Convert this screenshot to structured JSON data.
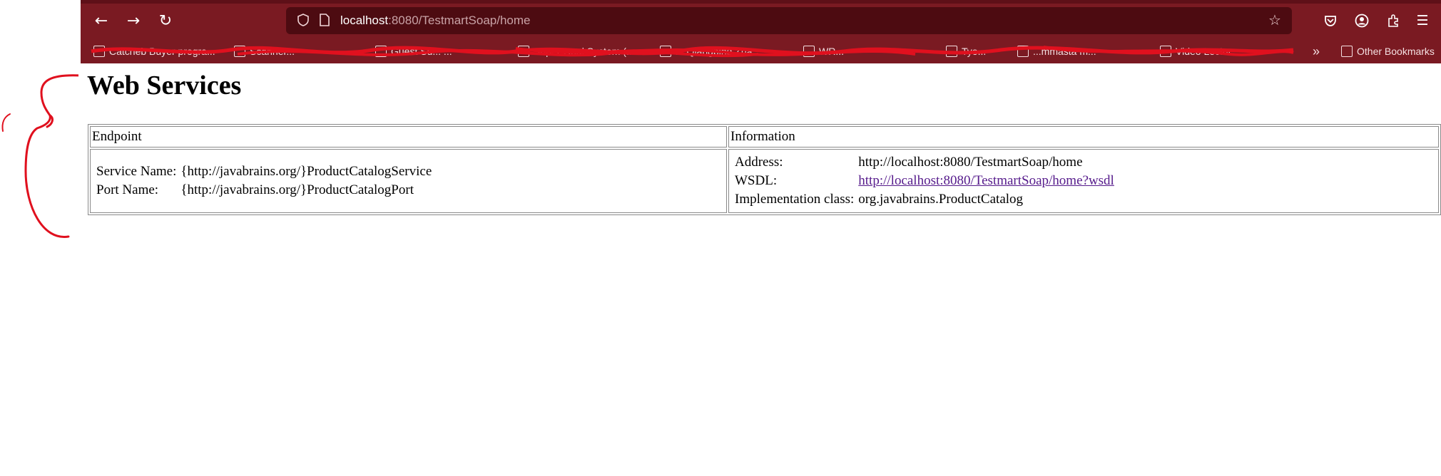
{
  "browser": {
    "url_host": "localhost",
    "url_rest": ":8080/TestmartSoap/home",
    "bookmarks": [
      "Catcheb Buyer progra...",
      "Scanner...",
      "Guest Su... ...",
      "Super Goal System (...",
      "... Qiangbing Zha...",
      "WR...",
      "Tyo...",
      "...mmästä m...",
      "Video Lectur...",
      "Other Bookmarks"
    ]
  },
  "page": {
    "title": "Web Services",
    "table": {
      "headers": [
        "Endpoint",
        "Information"
      ],
      "endpoint": {
        "service_label": "Service Name:",
        "service_value": "{http://javabrains.org/}ProductCatalogService",
        "port_label": "Port Name:",
        "port_value": "{http://javabrains.org/}ProductCatalogPort"
      },
      "information": {
        "address_label": "Address:",
        "address_value": "http://localhost:8080/TestmartSoap/home",
        "wsdl_label": "WSDL:",
        "wsdl_value": "http://localhost:8080/TestmartSoap/home?wsdl",
        "impl_label": "Implementation class:",
        "impl_value": "org.javabrains.ProductCatalog"
      }
    }
  },
  "colors": {
    "chrome": "#7a1a22",
    "urlbar": "#4d0b11",
    "link": "#551a8b",
    "annotation": "#e0101e"
  }
}
